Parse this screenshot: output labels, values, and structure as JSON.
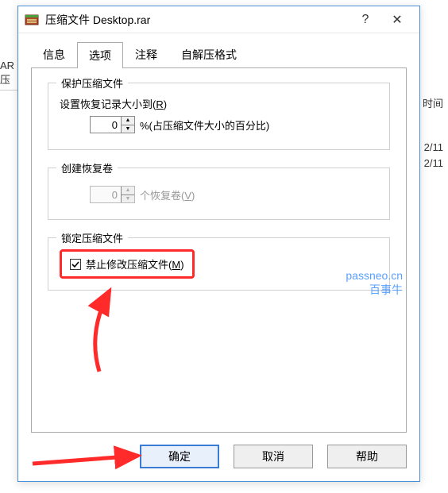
{
  "background": {
    "left_fragment": "AR 压",
    "col_time": "时间",
    "date1": "2/11",
    "date2": "2/11"
  },
  "dialog": {
    "title": "压缩文件 Desktop.rar",
    "help_symbol": "?",
    "close_symbol": "✕",
    "tabs": {
      "info": "信息",
      "options": "选项",
      "comment": "注释",
      "sfx": "自解压格式"
    },
    "protect": {
      "legend": "保护压缩文件",
      "label_prefix": "设置恢复记录大小到(",
      "label_hotkey": "R",
      "label_suffix": ")",
      "value": "0",
      "suffix": "%(占压缩文件大小的百分比)"
    },
    "recovery": {
      "legend": "创建恢复卷",
      "value": "0",
      "suffix_prefix": "个恢复卷(",
      "suffix_hotkey": "V",
      "suffix_suffix": ")"
    },
    "lock": {
      "legend": "锁定压缩文件",
      "checked": true,
      "label_prefix": "禁止修改压缩文件(",
      "label_hotkey": "M",
      "label_suffix": ")"
    },
    "buttons": {
      "ok": "确定",
      "cancel": "取消",
      "help": "帮助"
    }
  },
  "watermark": {
    "line1": "passneo.cn",
    "line2": "百事牛"
  },
  "annotation": {
    "arrow_color": "#ff2a2a"
  }
}
